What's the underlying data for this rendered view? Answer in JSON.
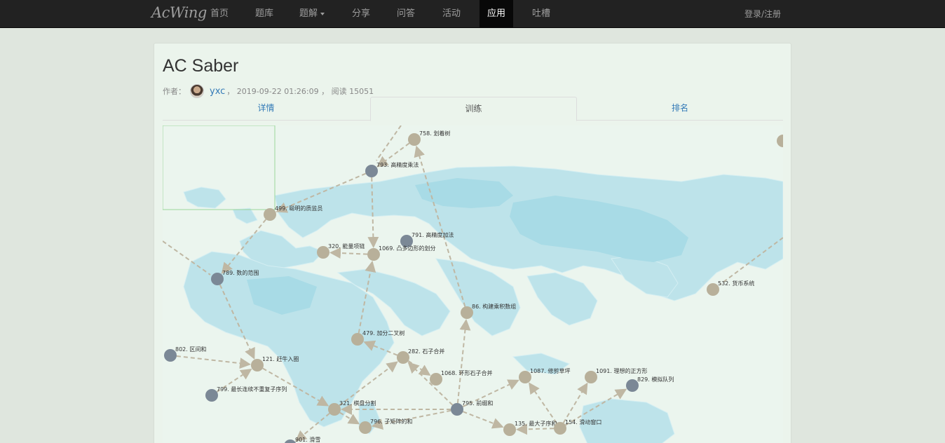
{
  "navbar": {
    "brand": "AcWing",
    "items": [
      "首页",
      "题库",
      "题解",
      "分享",
      "问答",
      "活动",
      "应用",
      "吐槽"
    ],
    "active": "应用",
    "login": "登录/注册"
  },
  "article": {
    "title": "AC Saber",
    "author_prefix": "作者：",
    "author": "yxc",
    "meta_suffix": "，  2019-09-22 01:26:09 ，  阅读 15051"
  },
  "tabs": [
    "详情",
    "训练",
    "排名"
  ],
  "active_tab": "训练",
  "graph": {
    "nodes": [
      {
        "id": "758",
        "label": "758. 划着树",
        "kind": "tan"
      },
      {
        "id": "793",
        "label": "793. 高精度乘法",
        "kind": "gray"
      },
      {
        "id": "499",
        "label": "499. 聪明的质监员",
        "kind": "tan"
      },
      {
        "id": "791",
        "label": "791. 高精度加法",
        "kind": "gray"
      },
      {
        "id": "320",
        "label": "320. 能量项链",
        "kind": "tan"
      },
      {
        "id": "1069",
        "label": "1069. 凸多边形的划分",
        "kind": "tan"
      },
      {
        "id": "789",
        "label": "789. 数的范围",
        "kind": "gray"
      },
      {
        "id": "532",
        "label": "532. 货币系统",
        "kind": "tan"
      },
      {
        "id": "86",
        "label": "86. 构建乘积数组",
        "kind": "tan"
      },
      {
        "id": "479",
        "label": "479. 加分二叉树",
        "kind": "tan"
      },
      {
        "id": "802",
        "label": "802. 区间和",
        "kind": "gray"
      },
      {
        "id": "282",
        "label": "282. 石子合并",
        "kind": "tan"
      },
      {
        "id": "121",
        "label": "121. 赶牛入圈",
        "kind": "tan"
      },
      {
        "id": "1068",
        "label": "1068. 环形石子合并",
        "kind": "tan"
      },
      {
        "id": "1087",
        "label": "1087. 修剪草坪",
        "kind": "tan"
      },
      {
        "id": "1091",
        "label": "1091. 理想的正方形",
        "kind": "tan"
      },
      {
        "id": "829",
        "label": "829. 模拟队列",
        "kind": "gray"
      },
      {
        "id": "799",
        "label": "799. 最长连续不重复子序列",
        "kind": "gray"
      },
      {
        "id": "321",
        "label": "321. 棋盘分割",
        "kind": "tan"
      },
      {
        "id": "795",
        "label": "795. 前缀和",
        "kind": "gray"
      },
      {
        "id": "796",
        "label": "796. 子矩阵的和",
        "kind": "tan"
      },
      {
        "id": "135",
        "label": "135. 最大子序和",
        "kind": "tan"
      },
      {
        "id": "154",
        "label": "154. 滑动窗口",
        "kind": "tan"
      },
      {
        "id": "901",
        "label": "901. 滑雪",
        "kind": "gray"
      },
      {
        "id": "edge-top-right",
        "label": "",
        "kind": "tan"
      }
    ],
    "edges": [
      [
        "758",
        "793"
      ],
      [
        "793",
        "499"
      ],
      [
        "793",
        "1069"
      ],
      [
        "86",
        "758"
      ],
      [
        "499",
        "789"
      ],
      [
        "789",
        "121"
      ],
      [
        "1069",
        "320"
      ],
      [
        "479",
        "1069"
      ],
      [
        "282",
        "479"
      ],
      [
        "282",
        "1068"
      ],
      [
        "795",
        "86"
      ],
      [
        "795",
        "282"
      ],
      [
        "802",
        "121"
      ],
      [
        "799",
        "121"
      ],
      [
        "121",
        "321"
      ],
      [
        "321",
        "282"
      ],
      [
        "795",
        "321"
      ],
      [
        "795",
        "796"
      ],
      [
        "795",
        "1087"
      ],
      [
        "795",
        "135"
      ],
      [
        "154",
        "135"
      ],
      [
        "154",
        "1087"
      ],
      [
        "154",
        "1091"
      ],
      [
        "154",
        "829"
      ],
      [
        "321",
        "796"
      ],
      [
        "321",
        "901"
      ]
    ],
    "colors": {
      "tan": "#b8b09a",
      "gray": "#7b8896",
      "edge": "#bfb7a3",
      "minimap": "#9bd69b"
    }
  }
}
